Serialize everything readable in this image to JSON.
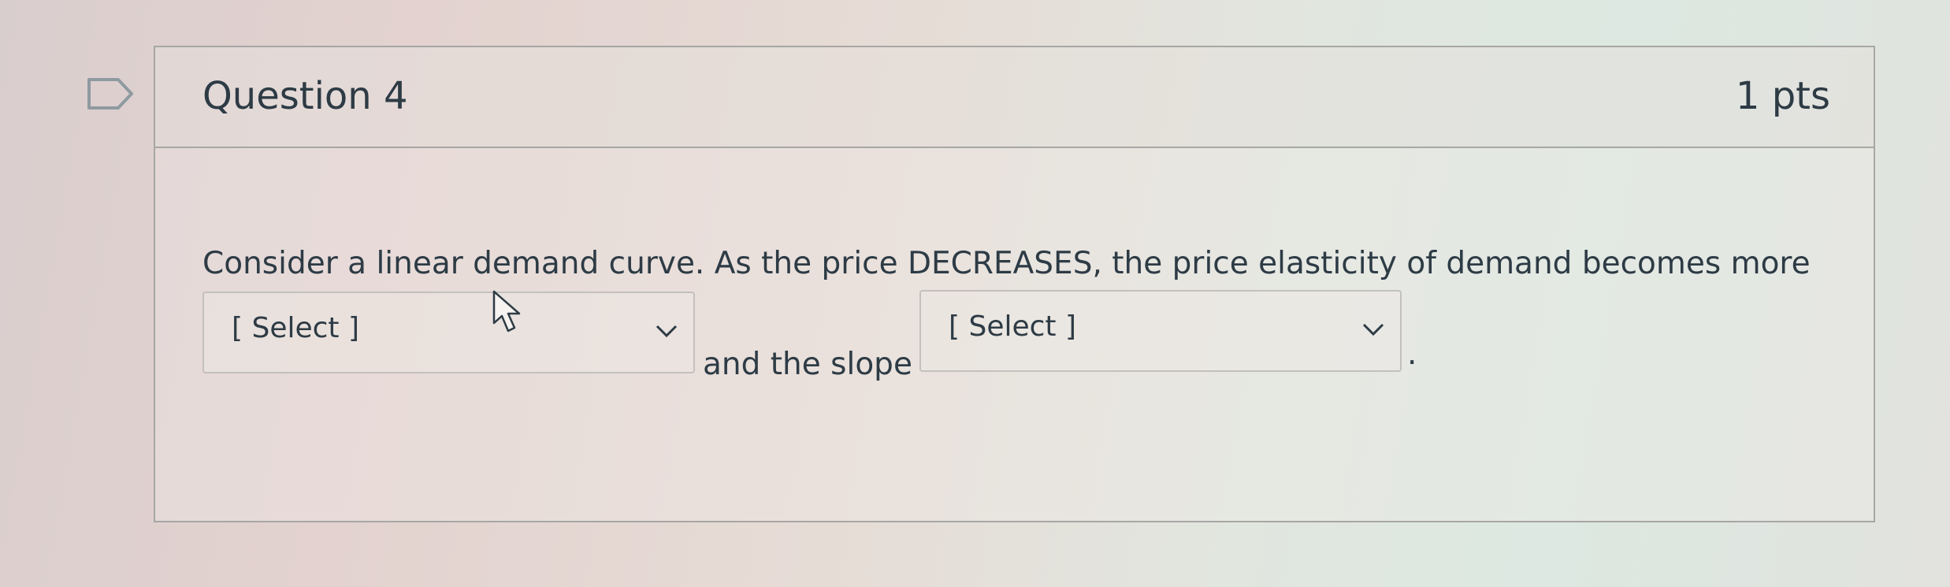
{
  "question": {
    "title": "Question 4",
    "points": "1 pts",
    "prompt": "Consider a linear demand curve. As the price DECREASES, the price elasticity of demand becomes more",
    "connector": "and the slope",
    "ending": "."
  },
  "dropdowns": [
    {
      "selected": "[ Select ]"
    },
    {
      "selected": "[ Select ]"
    }
  ],
  "icons": {
    "flag": "flag-icon",
    "dropdown_arrow": "chevron-down-icon",
    "cursor": "mouse-pointer-icon"
  },
  "colors": {
    "text": "#2d3b45",
    "border": "#a7a7a4",
    "select_border": "#c3c0bd",
    "flag_stroke": "#8f9aa0"
  }
}
